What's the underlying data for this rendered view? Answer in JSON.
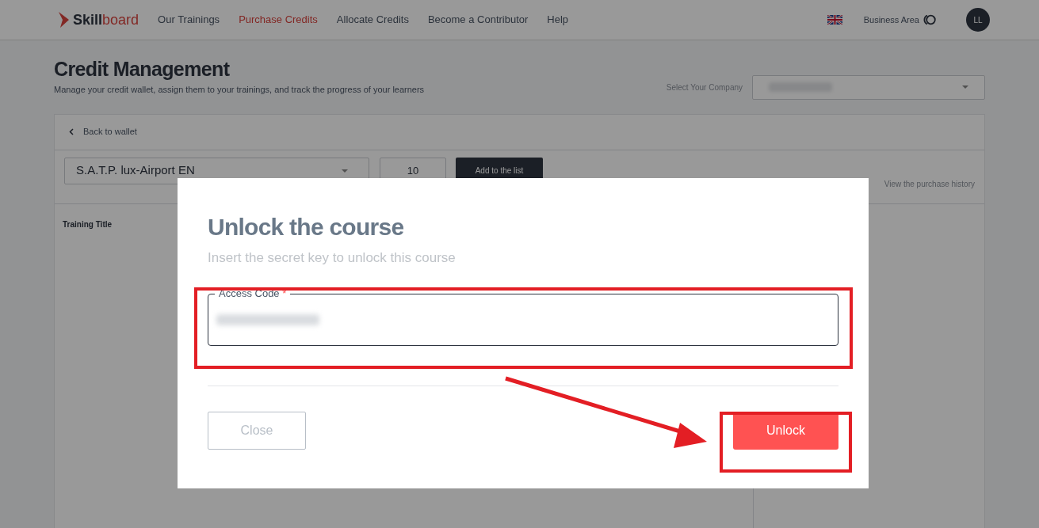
{
  "header": {
    "logo": {
      "part_1": "Skill",
      "part_2": "board"
    },
    "nav": [
      {
        "label": "Our Trainings",
        "selected": false
      },
      {
        "label": "Purchase Credits",
        "selected": true
      },
      {
        "label": "Allocate Credits",
        "selected": false
      },
      {
        "label": "Become a Contributor",
        "selected": false
      },
      {
        "label": "Help",
        "selected": false
      }
    ],
    "business_area": "Business Area",
    "avatar": "LL"
  },
  "page": {
    "title": "Credit Management",
    "subtitle": "Manage your credit wallet, assign them to your trainings, and track the progress of your learners",
    "company_label": "Select Your Company"
  },
  "card": {
    "back": "Back to wallet",
    "training_select": "S.A.T.P. lux-Airport EN",
    "quantity": "10",
    "add_button": "Add to the list",
    "history_link": "View the purchase history",
    "column_1": "Training Title"
  },
  "modal": {
    "title": "Unlock the course",
    "subtitle": "Insert the secret key to unlock this course",
    "field_label": "Access Code",
    "required_mark": "*",
    "close_button": "Close",
    "unlock_button": "Unlock"
  }
}
